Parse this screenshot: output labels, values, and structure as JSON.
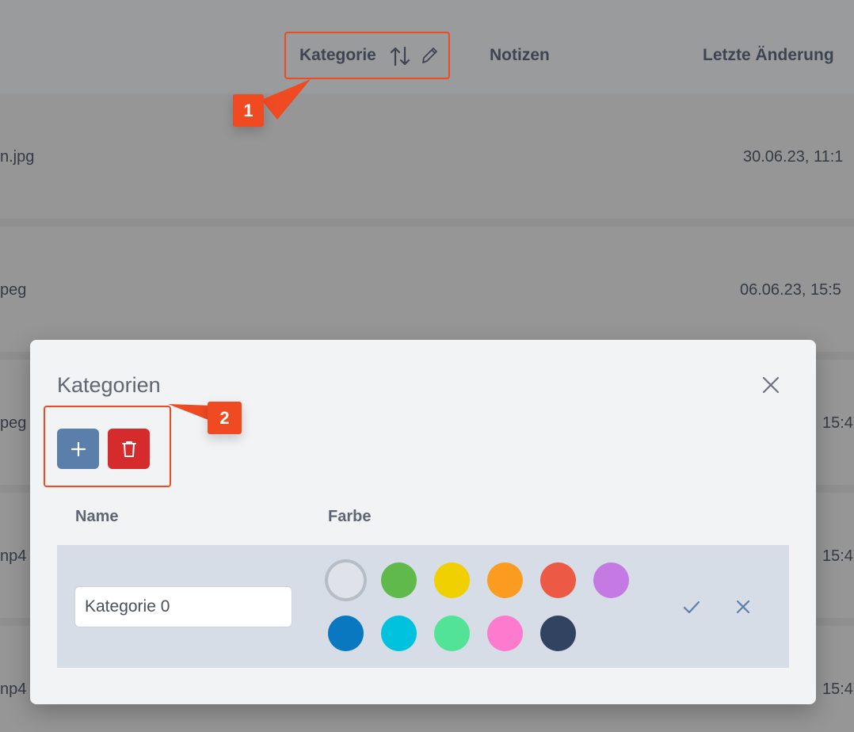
{
  "table": {
    "columns": {
      "category": "Kategorie",
      "notes": "Notizen",
      "last_modified": "Letzte Änderung"
    },
    "rows": [
      {
        "file": "n.jpg",
        "date": "30.06.23, 11:1"
      },
      {
        "file": "peg",
        "date": "06.06.23, 15:5"
      },
      {
        "file": "peg",
        "date": "15:4"
      },
      {
        "file": "np4",
        "date": "15:4"
      },
      {
        "file": "np4",
        "date": "15:4"
      }
    ]
  },
  "annotations": {
    "marker1": "1",
    "marker2": "2"
  },
  "modal": {
    "title": "Kategorien",
    "add_button_icon": "plus-icon",
    "delete_button_icon": "trash-icon",
    "headers": {
      "name": "Name",
      "color": "Farbe"
    },
    "category_row": {
      "name_value": "Kategorie 0",
      "selected_color_index": 0
    },
    "colors": [
      "#dfe2e8",
      "#5fba4b",
      "#f0d000",
      "#fb9c20",
      "#ec5a45",
      "#c57ae3",
      "#0a78c0",
      "#00c2de",
      "#52e396",
      "#fd7bce",
      "#324261"
    ]
  }
}
